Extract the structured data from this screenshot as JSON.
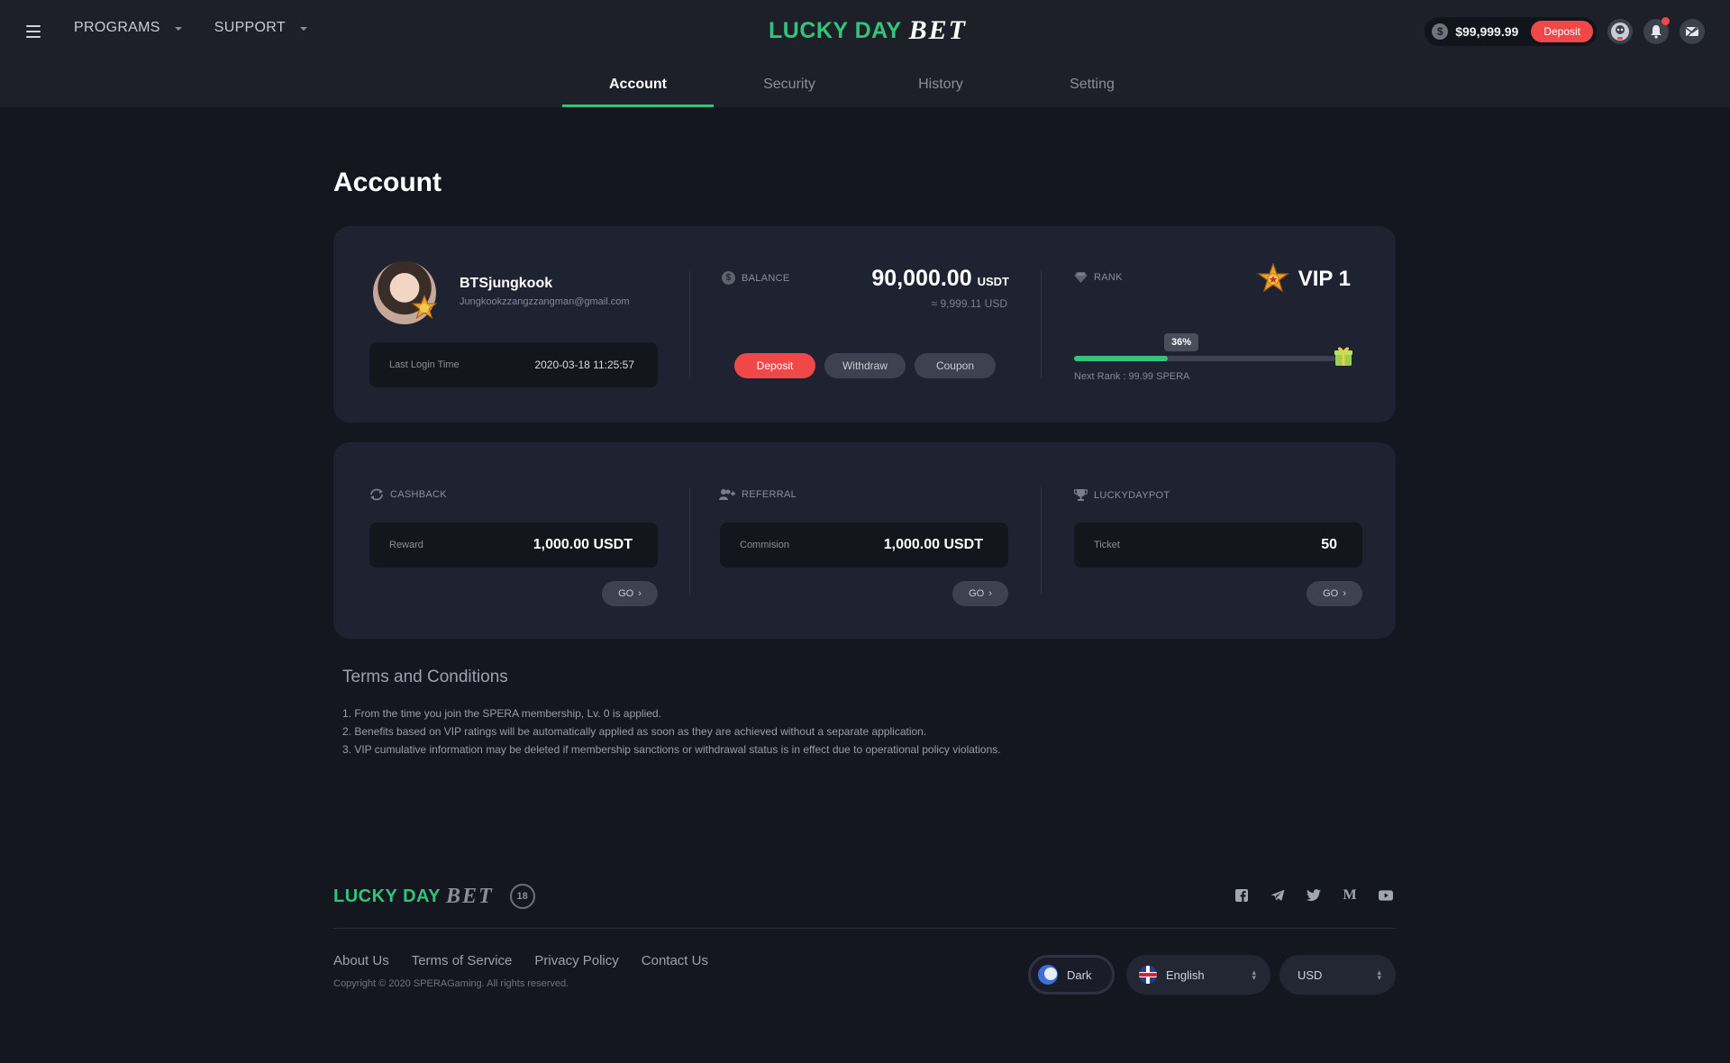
{
  "header": {
    "nav": [
      {
        "label": "PROGRAMS"
      },
      {
        "label": "SUPPORT"
      }
    ],
    "logo": {
      "lucky": "LUCKY DAY",
      "bet": "BET"
    },
    "wallet": {
      "amount": "$99,999.99",
      "deposit_label": "Deposit"
    },
    "icons": [
      "avatar-icon",
      "bell-icon",
      "message-icon"
    ]
  },
  "tabs": [
    {
      "label": "Account",
      "active": true
    },
    {
      "label": "Security",
      "active": false
    },
    {
      "label": "History",
      "active": false
    },
    {
      "label": "Setting",
      "active": false
    }
  ],
  "page": {
    "title": "Account"
  },
  "profile": {
    "username": "BTSjungkook",
    "email": "Jungkookzzangzzangman@gmail.com",
    "last_login_label": "Last Login Time",
    "last_login_value": "2020-03-18 11:25:57"
  },
  "balance": {
    "label": "BALANCE",
    "amount": "90,000.00",
    "currency": "USDT",
    "usd_equiv": "≈ 9,999.11 USD",
    "buttons": {
      "deposit": "Deposit",
      "withdraw": "Withdraw",
      "coupon": "Coupon"
    }
  },
  "rank": {
    "label": "RANK",
    "value": "VIP 1",
    "progress_percent": 36,
    "progress_label": "36%",
    "next_rank": "Next Rank : 99.99 SPERA"
  },
  "cashback": {
    "label": "CASHBACK",
    "field_label": "Reward",
    "value": "1,000.00 USDT",
    "go": "GO"
  },
  "referral": {
    "label": "REFERRAL",
    "field_label": "Commision",
    "value": "1,000.00 USDT",
    "go": "GO"
  },
  "luckydaypot": {
    "label": "LUCKYDAYPOT",
    "field_label": "Ticket",
    "value": "50",
    "go": "GO"
  },
  "terms": {
    "title": "Terms and Conditions",
    "items": [
      "1. From the time you join the SPERA membership, Lv. 0 is applied.",
      "2. Benefits based on VIP ratings will be automatically applied as soon as they are achieved without a separate application.",
      "3. VIP cumulative information may be deleted if membership sanctions or withdrawal status is in effect due to operational policy violations."
    ]
  },
  "footer": {
    "age": "18",
    "links": [
      "About Us",
      "Terms of Service",
      "Privacy Policy",
      "Contact Us"
    ],
    "copyright": "Copyright © 2020 SPERAGaming. All rights reserved.",
    "socials": [
      "facebook-icon",
      "telegram-icon",
      "twitter-icon",
      "medium-icon",
      "youtube-icon"
    ],
    "theme": "Dark",
    "language": "English",
    "currency": "USD"
  },
  "colors": {
    "accent": "#33c47a",
    "danger": "#f04848",
    "background": "#141720",
    "card": "#1f2230"
  }
}
